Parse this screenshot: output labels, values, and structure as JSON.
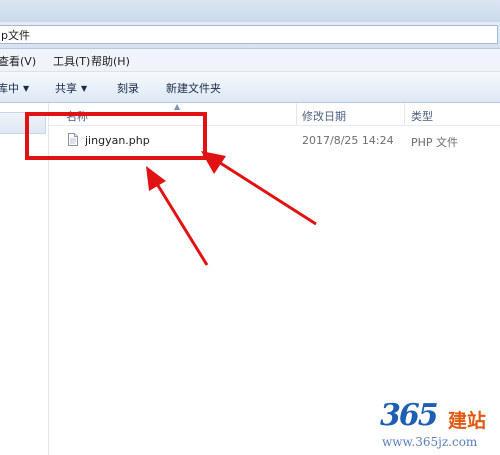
{
  "address": {
    "path_text": "p文件"
  },
  "menubar": {
    "items": [
      "查看(V)",
      "工具(T)",
      "帮助(H)"
    ]
  },
  "toolbar": {
    "organize_label": "库中",
    "share_label": "共享",
    "burn_label": "刻录",
    "new_folder_label": "新建文件夹"
  },
  "columns": {
    "name": "名称",
    "date": "修改日期",
    "type": "类型"
  },
  "files": [
    {
      "name": "jingyan.php",
      "date": "2017/8/25 14:24",
      "type": "PHP 文件"
    }
  ],
  "annotation": {
    "highlight_color": "#e01212",
    "arrow_color": "#e01212"
  },
  "watermark": {
    "number": "365",
    "brand_text": "建站",
    "url": "www.365jz.com",
    "number_color": "#1d5fb3",
    "brand_color": "#e25a12"
  }
}
